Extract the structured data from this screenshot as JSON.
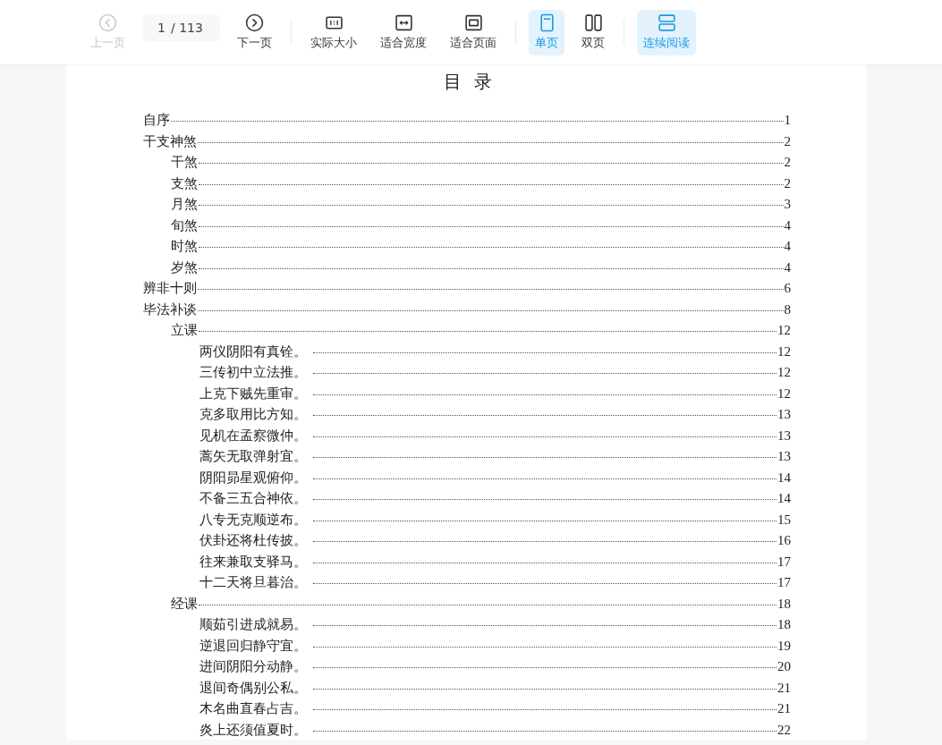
{
  "toolbar": {
    "groups": [
      [
        {
          "kind": "prev",
          "label": "上一页",
          "disabled": true,
          "selected": false
        },
        {
          "kind": "page_field",
          "value": "1",
          "total": "/ 113"
        },
        {
          "kind": "next",
          "label": "下一页",
          "disabled": false,
          "selected": false
        }
      ],
      [
        {
          "kind": "actual_size",
          "label": "实际大小",
          "disabled": false,
          "selected": false
        },
        {
          "kind": "fit_width",
          "label": "适合宽度",
          "disabled": false,
          "selected": false
        },
        {
          "kind": "fit_page",
          "label": "适合页面",
          "disabled": false,
          "selected": false
        }
      ],
      [
        {
          "kind": "single",
          "label": "单页",
          "disabled": false,
          "selected": true
        },
        {
          "kind": "double",
          "label": "双页",
          "disabled": false,
          "selected": false
        }
      ],
      [
        {
          "kind": "continuous",
          "label": "连续阅读",
          "disabled": false,
          "selected": true
        }
      ]
    ]
  },
  "document": {
    "title": "目 录",
    "toc": [
      {
        "title": "自序",
        "page": "1"
      },
      {
        "title": "干支神煞",
        "page": "2",
        "children": [
          {
            "title": "干煞",
            "page": "2"
          },
          {
            "title": "支煞",
            "page": "2"
          },
          {
            "title": "月煞",
            "page": "3"
          },
          {
            "title": "旬煞",
            "page": "4"
          },
          {
            "title": "时煞",
            "page": "4"
          },
          {
            "title": "岁煞",
            "page": "4"
          }
        ]
      },
      {
        "title": "辨非十则",
        "page": "6"
      },
      {
        "title": "毕法补谈",
        "page": "8",
        "children": [
          {
            "title": "立课",
            "page": "12",
            "children": [
              {
                "title": "两仪阴阳有真铨。",
                "page": "12"
              },
              {
                "title": "三传初中立法推。",
                "page": "12"
              },
              {
                "title": "上克下贼先重审。",
                "page": "12"
              },
              {
                "title": "克多取用比方知。",
                "page": "13"
              },
              {
                "title": "见机在孟察微仲。",
                "page": "13"
              },
              {
                "title": "蒿矢无取弹射宜。",
                "page": "13"
              },
              {
                "title": "阴阳昴星观俯仰。",
                "page": "14"
              },
              {
                "title": "不备三五合神依。",
                "page": "14"
              },
              {
                "title": "八专无克顺逆布。",
                "page": "15"
              },
              {
                "title": "伏卦还将杜传披。",
                "page": "16"
              },
              {
                "title": "往来兼取支驿马。",
                "page": "17"
              },
              {
                "title": "十二天将旦暮治。",
                "page": "17"
              }
            ]
          },
          {
            "title": "经课",
            "page": "18",
            "children": [
              {
                "title": "顺茹引进成就易。",
                "page": "18"
              },
              {
                "title": "逆退回归静守宜。",
                "page": "19"
              },
              {
                "title": "进间阴阳分动静。",
                "page": "20"
              },
              {
                "title": "退间奇偶别公私。",
                "page": "21"
              },
              {
                "title": "木名曲直春占吉。",
                "page": "21"
              },
              {
                "title": "炎上还须值夏时。",
                "page": "22"
              }
            ]
          }
        ]
      }
    ]
  }
}
